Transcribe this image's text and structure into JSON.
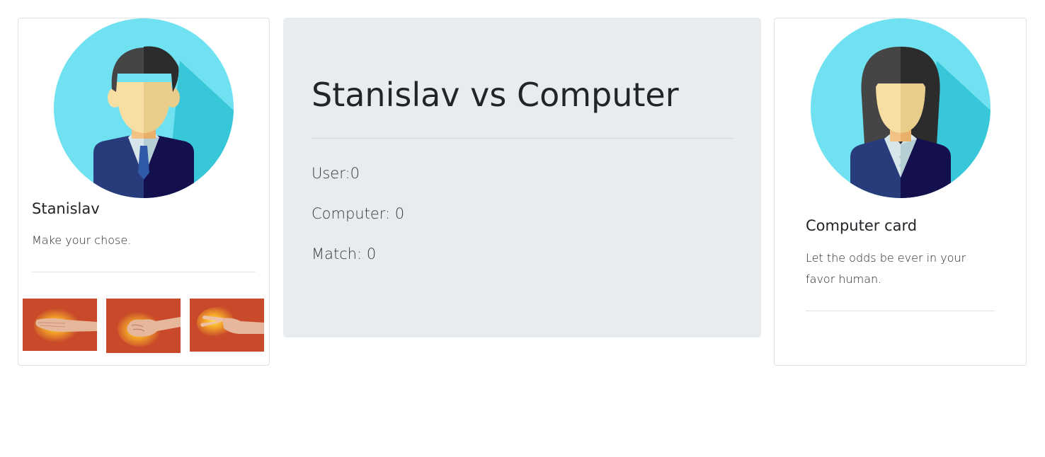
{
  "user_card": {
    "name": "Stanislav",
    "text": "Make your chose.",
    "choices": [
      {
        "name": "paper",
        "icon": "open-hand-icon"
      },
      {
        "name": "rock",
        "icon": "fist-icon"
      },
      {
        "name": "scissors",
        "icon": "two-fingers-icon"
      }
    ]
  },
  "main": {
    "title": "Stanislav vs Computer",
    "user_score": "User:0",
    "computer_score": "Computer: 0",
    "match_score": "Match: 0"
  },
  "computer_card": {
    "title": "Computer card",
    "text": "Let the odds be ever in your favor human."
  },
  "colors": {
    "avatar_bg": "#6fe1f0",
    "avatar_shadow": "#38c6d9",
    "suit": "#283c7c",
    "suit_dark": "#14104d",
    "hair": "#333333",
    "skin": "#f7dea3",
    "choice_bg": "#c84a2a",
    "jumbotron_bg": "#e9ecef"
  }
}
